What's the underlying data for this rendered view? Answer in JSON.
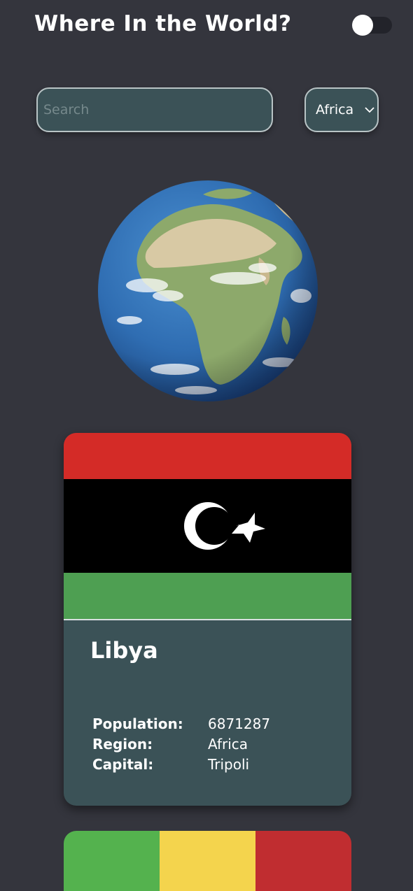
{
  "header": {
    "title": "Where In the World?",
    "theme_toggle_on": false
  },
  "filters": {
    "search_placeholder": "Search",
    "search_value": "",
    "region_selected": "Africa"
  },
  "countries": [
    {
      "name": "Libya",
      "population_label": "Population:",
      "population": "6871287",
      "region_label": "Region:",
      "region": "Africa",
      "capital_label": "Capital:",
      "capital": "Tripoli",
      "flag_colors": [
        "#d42b27",
        "#000000",
        "#4e9f52"
      ]
    },
    {
      "flag_colors": [
        "#54b24e",
        "#f4d44d",
        "#c02d30"
      ]
    }
  ],
  "colors": {
    "background": "#34353d",
    "card": "#3b5257",
    "input_border": "#b9c4c6"
  }
}
